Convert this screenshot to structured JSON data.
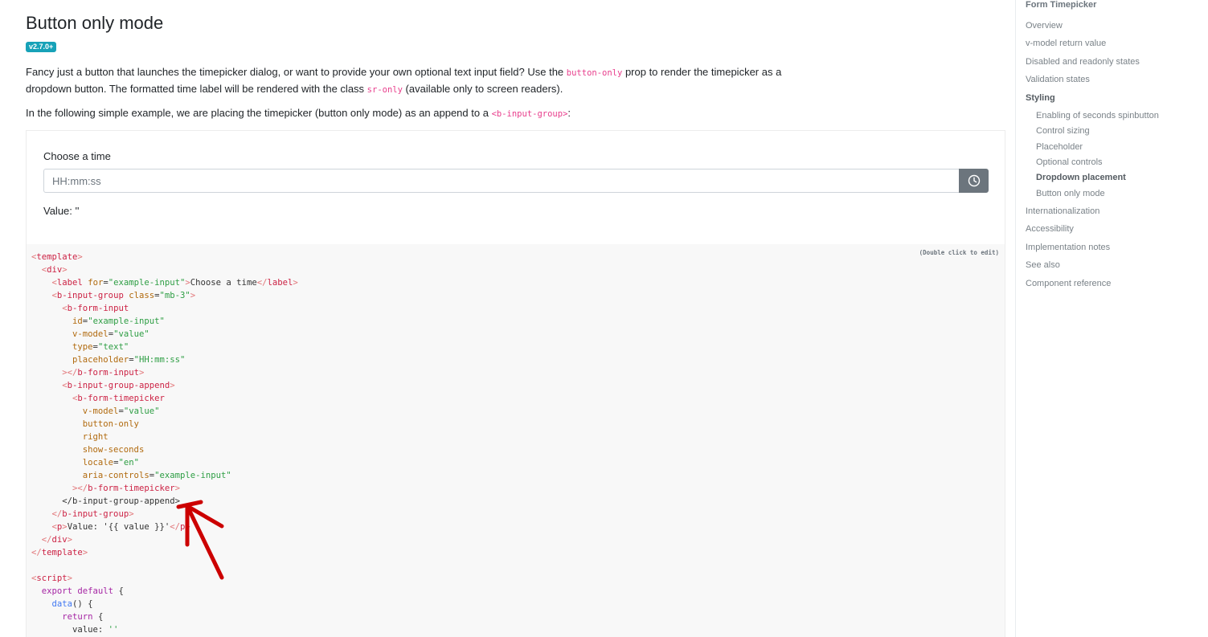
{
  "page": {
    "title": "Button only mode",
    "version_badge": "v2.7.0+",
    "intro_part1": "Fancy just a button that launches the timepicker dialog, or want to provide your own optional text input field? Use the ",
    "intro_code1": "button-only",
    "intro_part2": " prop to render the timepicker as a dropdown button. The formatted time label will be rendered with the class ",
    "intro_code2": "sr-only",
    "intro_part3": " (available only to screen readers).",
    "example_part1": "In the following simple example, we are placing the timepicker (button only mode) as an append to a ",
    "example_code": "<b-input-group>",
    "example_part2": ":"
  },
  "example": {
    "label": "Choose a time",
    "input_value": "",
    "input_placeholder": "HH:mm:ss",
    "value_text": "Value: ''",
    "button_icon": "clock-icon"
  },
  "code": {
    "hint": "(Double click to edit)",
    "lines": [
      [
        [
          "tag",
          "<"
        ],
        [
          "tagname",
          "template"
        ],
        [
          "tag",
          ">"
        ]
      ],
      [
        [
          "pl",
          "  "
        ],
        [
          "tag",
          "<"
        ],
        [
          "tagname",
          "div"
        ],
        [
          "tag",
          ">"
        ]
      ],
      [
        [
          "pl",
          "    "
        ],
        [
          "tag",
          "<"
        ],
        [
          "tagname",
          "label"
        ],
        [
          "pl",
          " "
        ],
        [
          "attr",
          "for"
        ],
        [
          "pl",
          "="
        ],
        [
          "str",
          "\"example-input\""
        ],
        [
          "tag",
          ">"
        ],
        [
          "pl",
          "Choose a time"
        ],
        [
          "tag",
          "</"
        ],
        [
          "tagname",
          "label"
        ],
        [
          "tag",
          ">"
        ]
      ],
      [
        [
          "pl",
          "    "
        ],
        [
          "tag",
          "<"
        ],
        [
          "tagname",
          "b-input-group"
        ],
        [
          "pl",
          " "
        ],
        [
          "attr",
          "class"
        ],
        [
          "pl",
          "="
        ],
        [
          "str",
          "\"mb-3\""
        ],
        [
          "tag",
          ">"
        ]
      ],
      [
        [
          "pl",
          "      "
        ],
        [
          "tag",
          "<"
        ],
        [
          "tagname",
          "b-form-input"
        ]
      ],
      [
        [
          "pl",
          "        "
        ],
        [
          "attr",
          "id"
        ],
        [
          "pl",
          "="
        ],
        [
          "str",
          "\"example-input\""
        ]
      ],
      [
        [
          "pl",
          "        "
        ],
        [
          "attr",
          "v-model"
        ],
        [
          "pl",
          "="
        ],
        [
          "str",
          "\"value\""
        ]
      ],
      [
        [
          "pl",
          "        "
        ],
        [
          "attr",
          "type"
        ],
        [
          "pl",
          "="
        ],
        [
          "str",
          "\"text\""
        ]
      ],
      [
        [
          "pl",
          "        "
        ],
        [
          "attr",
          "placeholder"
        ],
        [
          "pl",
          "="
        ],
        [
          "str",
          "\"HH:mm:ss\""
        ]
      ],
      [
        [
          "pl",
          "      "
        ],
        [
          "tag",
          "></"
        ],
        [
          "tagname",
          "b-form-input"
        ],
        [
          "tag",
          ">"
        ]
      ],
      [
        [
          "pl",
          "      "
        ],
        [
          "tag",
          "<"
        ],
        [
          "tagname",
          "b-input-group-append"
        ],
        [
          "tag",
          ">"
        ]
      ],
      [
        [
          "pl",
          "        "
        ],
        [
          "tag",
          "<"
        ],
        [
          "tagname",
          "b-form-timepicker"
        ]
      ],
      [
        [
          "pl",
          "          "
        ],
        [
          "attr",
          "v-model"
        ],
        [
          "pl",
          "="
        ],
        [
          "str",
          "\"value\""
        ]
      ],
      [
        [
          "pl",
          "          "
        ],
        [
          "attr",
          "button-only"
        ]
      ],
      [
        [
          "pl",
          "          "
        ],
        [
          "attr",
          "right"
        ]
      ],
      [
        [
          "pl",
          "          "
        ],
        [
          "attr",
          "show-seconds"
        ]
      ],
      [
        [
          "pl",
          "          "
        ],
        [
          "attr",
          "locale"
        ],
        [
          "pl",
          "="
        ],
        [
          "str",
          "\"en\""
        ]
      ],
      [
        [
          "pl",
          "          "
        ],
        [
          "attr",
          "aria-controls"
        ],
        [
          "pl",
          "="
        ],
        [
          "str",
          "\"example-input\""
        ]
      ],
      [
        [
          "pl",
          "        "
        ],
        [
          "tag",
          "></"
        ],
        [
          "tagname",
          "b-form-timepicker"
        ],
        [
          "tag",
          ">"
        ]
      ],
      [
        [
          "pl",
          "      </b-input-group-append>"
        ]
      ],
      [
        [
          "pl",
          "    "
        ],
        [
          "tag",
          "</"
        ],
        [
          "tagname",
          "b-input-group"
        ],
        [
          "tag",
          ">"
        ]
      ],
      [
        [
          "pl",
          "    "
        ],
        [
          "tag",
          "<"
        ],
        [
          "tagname",
          "p"
        ],
        [
          "tag",
          ">"
        ],
        [
          "pl",
          "Value: '{{ value }}'"
        ],
        [
          "tag",
          "</"
        ],
        [
          "tagname",
          "p"
        ],
        [
          "tag",
          ">"
        ]
      ],
      [
        [
          "pl",
          "  "
        ],
        [
          "tag",
          "</"
        ],
        [
          "tagname",
          "div"
        ],
        [
          "tag",
          ">"
        ]
      ],
      [
        [
          "tag",
          "</"
        ],
        [
          "tagname",
          "template"
        ],
        [
          "tag",
          ">"
        ]
      ],
      [
        [
          "pl",
          ""
        ]
      ],
      [
        [
          "tag",
          "<"
        ],
        [
          "tagname",
          "script"
        ],
        [
          "tag",
          ">"
        ]
      ],
      [
        [
          "pl",
          "  "
        ],
        [
          "kw",
          "export default"
        ],
        [
          "pl",
          " {"
        ]
      ],
      [
        [
          "pl",
          "    "
        ],
        [
          "fn",
          "data"
        ],
        [
          "pl",
          "() {"
        ]
      ],
      [
        [
          "pl",
          "      "
        ],
        [
          "kw",
          "return"
        ],
        [
          "pl",
          " {"
        ]
      ],
      [
        [
          "pl",
          "        value: "
        ],
        [
          "str",
          "''"
        ]
      ]
    ]
  },
  "sidebar": {
    "heading": "Form Timepicker",
    "items": [
      {
        "label": "Overview",
        "level": 0,
        "bold": false
      },
      {
        "label": "v-model return value",
        "level": 0,
        "bold": false
      },
      {
        "label": "Disabled and readonly states",
        "level": 0,
        "bold": false
      },
      {
        "label": "Validation states",
        "level": 0,
        "bold": false
      },
      {
        "label": "Styling",
        "level": 0,
        "bold": true
      },
      {
        "label": "Enabling of seconds spinbutton",
        "level": 1,
        "bold": false
      },
      {
        "label": "Control sizing",
        "level": 1,
        "bold": false
      },
      {
        "label": "Placeholder",
        "level": 1,
        "bold": false
      },
      {
        "label": "Optional controls",
        "level": 1,
        "bold": false
      },
      {
        "label": "Dropdown placement",
        "level": 1,
        "bold": true
      },
      {
        "label": "Button only mode",
        "level": 1,
        "bold": false
      },
      {
        "label": "Internationalization",
        "level": 0,
        "bold": false
      },
      {
        "label": "Accessibility",
        "level": 0,
        "bold": false
      },
      {
        "label": "Implementation notes",
        "level": 0,
        "bold": false
      },
      {
        "label": "See also",
        "level": 0,
        "bold": false
      },
      {
        "label": "Component reference",
        "level": 0,
        "bold": false
      }
    ]
  },
  "colors": {
    "badge": "#17a2b8",
    "button": "#6c757d",
    "annotation_arrow": "#cc0000"
  }
}
